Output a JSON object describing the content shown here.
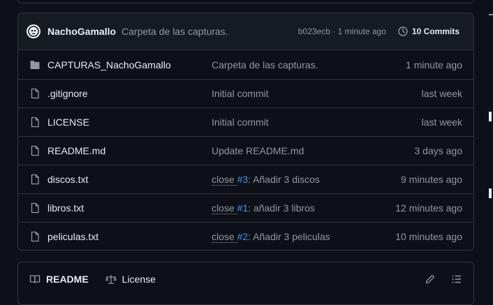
{
  "latest_commit": {
    "author": "NachoGamallo",
    "message": "Carpeta de las capturas.",
    "meta": "b023ecb · 1 minute ago",
    "commits_label": "10 Commits"
  },
  "files": [
    {
      "type": "folder",
      "name": "CAPTURAS_NachoGamallo",
      "commit_text": "Carpeta de las capturas.",
      "time": "1 minute ago"
    },
    {
      "type": "file",
      "name": ".gitignore",
      "commit_text": "Initial commit",
      "time": "last week"
    },
    {
      "type": "file",
      "name": "LICENSE",
      "commit_text": "Initial commit",
      "time": "last week"
    },
    {
      "type": "file",
      "name": "README.md",
      "commit_text": "Update README.md",
      "time": "3 days ago"
    },
    {
      "type": "file",
      "name": "discos.txt",
      "commit_prefix": "close ",
      "commit_issue": "#3",
      "commit_suffix": ": Añadir 3 discos",
      "time": "9 minutes ago"
    },
    {
      "type": "file",
      "name": "libros.txt",
      "commit_prefix": "close ",
      "commit_issue": "#1",
      "commit_suffix": ": añadir 3 libros",
      "time": "12 minutes ago"
    },
    {
      "type": "file",
      "name": "peliculas.txt",
      "commit_prefix": "close ",
      "commit_issue": "#2",
      "commit_suffix": ": Añadir 3 peliculas",
      "time": "10 minutes ago"
    }
  ],
  "readme_tabs": {
    "readme": "README",
    "license": "License"
  },
  "icons": {
    "folder": "folder-icon",
    "file": "file-icon",
    "history": "history-icon",
    "book": "book-icon",
    "law": "law-icon",
    "pencil": "pencil-icon",
    "list": "list-icon"
  },
  "colors": {
    "background": "#0d1117",
    "header_bg": "#161b22",
    "border": "#30363d",
    "text": "#e6edf3",
    "muted": "#9198a1",
    "link": "#4493f8"
  }
}
